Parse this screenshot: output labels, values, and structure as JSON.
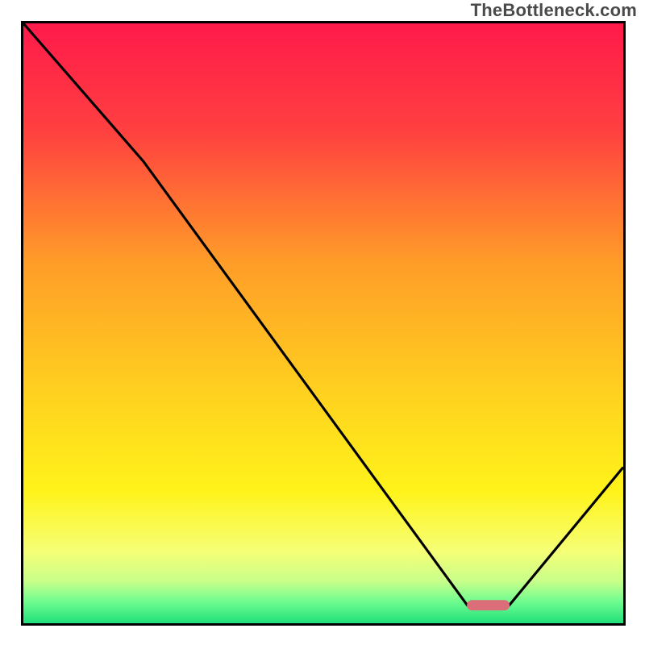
{
  "attribution": "TheBottleneck.com",
  "chart_data": {
    "type": "line",
    "title": "",
    "xlabel": "",
    "ylabel": "",
    "ylim": [
      0,
      100
    ],
    "xlim": [
      0,
      100
    ],
    "x": [
      0,
      20,
      74,
      81,
      100
    ],
    "values": [
      100,
      77,
      3,
      3,
      26
    ],
    "marker": {
      "x_start": 74,
      "x_end": 81,
      "y": 3
    },
    "gradient_stops": [
      {
        "offset": 0,
        "color": "#ff1a4b"
      },
      {
        "offset": 0.18,
        "color": "#ff4040"
      },
      {
        "offset": 0.4,
        "color": "#ff9d28"
      },
      {
        "offset": 0.62,
        "color": "#ffd21f"
      },
      {
        "offset": 0.78,
        "color": "#fff31a"
      },
      {
        "offset": 0.88,
        "color": "#f6ff76"
      },
      {
        "offset": 0.93,
        "color": "#c8ff8a"
      },
      {
        "offset": 0.965,
        "color": "#6dfc8f"
      },
      {
        "offset": 1.0,
        "color": "#20e07a"
      }
    ]
  },
  "colors": {
    "curve": "#000000",
    "marker": "#db6e78",
    "border": "#000000"
  }
}
